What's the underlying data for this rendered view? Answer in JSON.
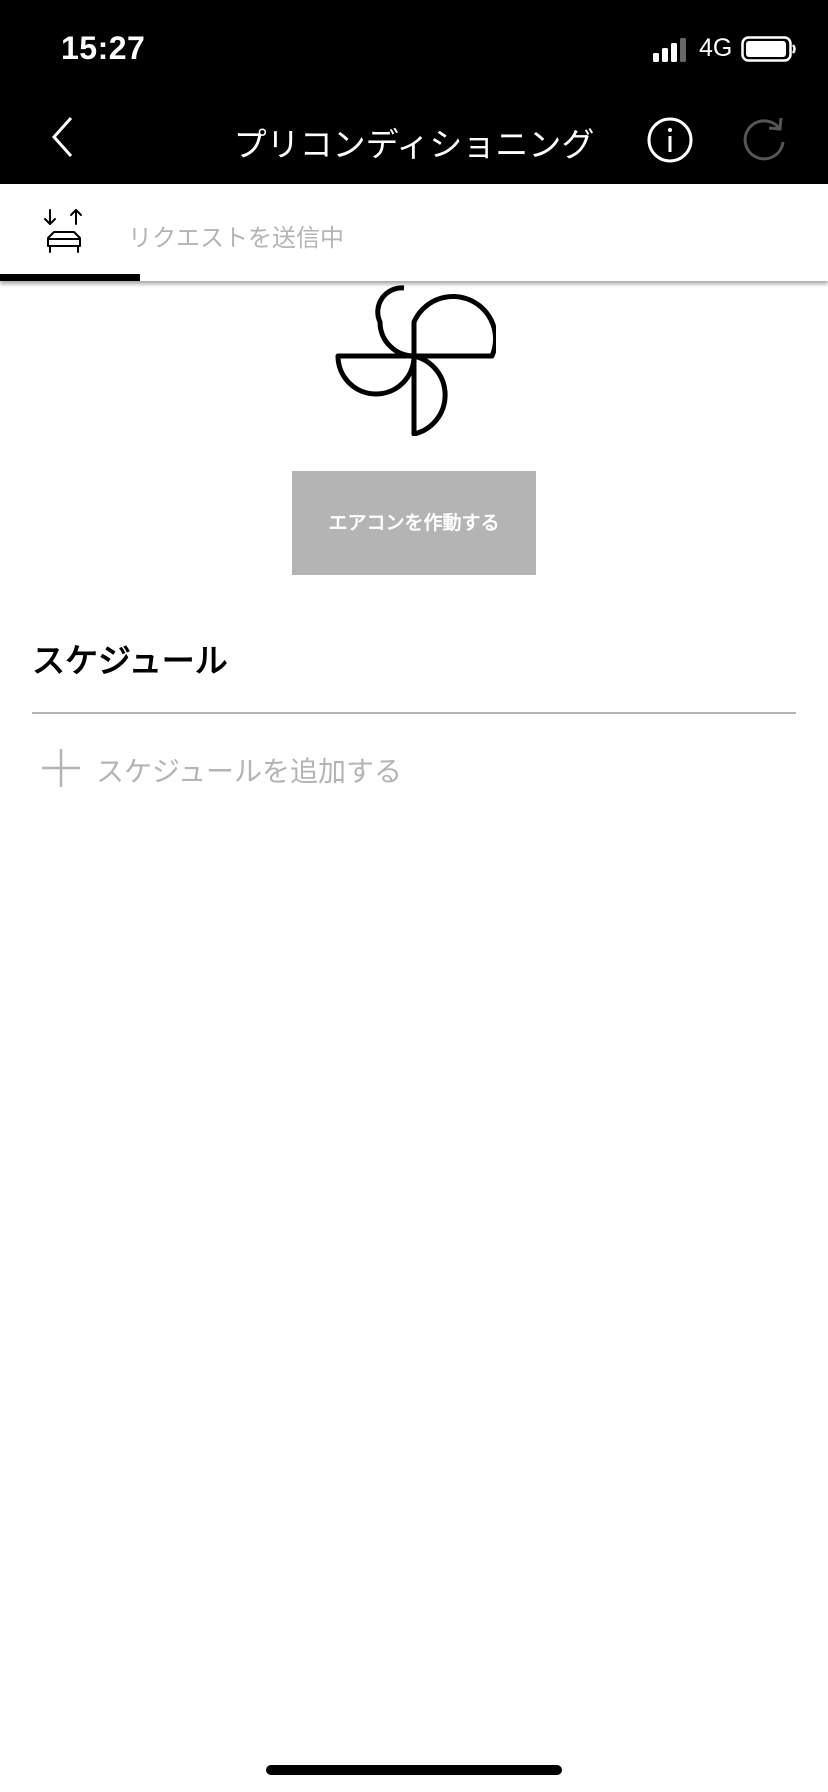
{
  "status_bar": {
    "time": "15:27",
    "network": "4G",
    "icons": [
      "signal-icon",
      "battery-icon"
    ]
  },
  "nav": {
    "title": "プリコンディショニング",
    "icons": [
      "back-chevron-icon",
      "info-icon",
      "refresh-icon"
    ]
  },
  "request": {
    "label": "リクエストを送信中",
    "icon": "car-transfer-icon"
  },
  "climate": {
    "icon": "fan-icon",
    "button_label": "エアコンを作動する"
  },
  "schedule": {
    "heading": "スケジュール",
    "add_label": "スケジュールを追加する",
    "add_icon": "plus-icon"
  },
  "colors": {
    "bar_background": "#000000",
    "muted_text": "#b4b4b4",
    "button_disabled": "#b4b4b4"
  }
}
